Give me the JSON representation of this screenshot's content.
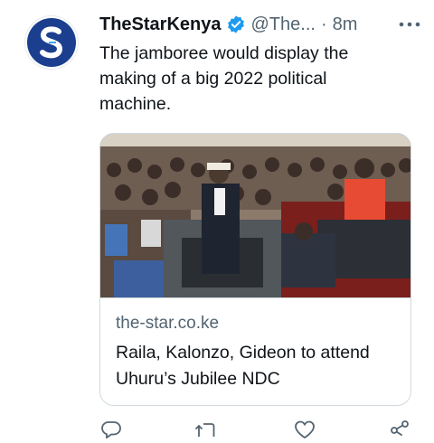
{
  "tweet": {
    "author_name": "TheStarKenya",
    "handle": "@The...",
    "separator": "·",
    "time": "8m",
    "text": "The jamboree would display the making of a big 2022 political machine."
  },
  "card": {
    "domain": "the-star.co.ke",
    "title": "Raila, Kalonzo, Gideon to attend Uhuru’s Jubilee NDC"
  },
  "icons": {
    "verified": "verified-badge-icon",
    "more": "more-icon",
    "reply": "reply-icon",
    "retweet": "retweet-icon",
    "like": "like-icon",
    "share": "share-icon"
  },
  "colors": {
    "brand_blue": "#1b3f8e",
    "verified_blue": "#1d9bf0",
    "secondary_text": "#536471"
  }
}
